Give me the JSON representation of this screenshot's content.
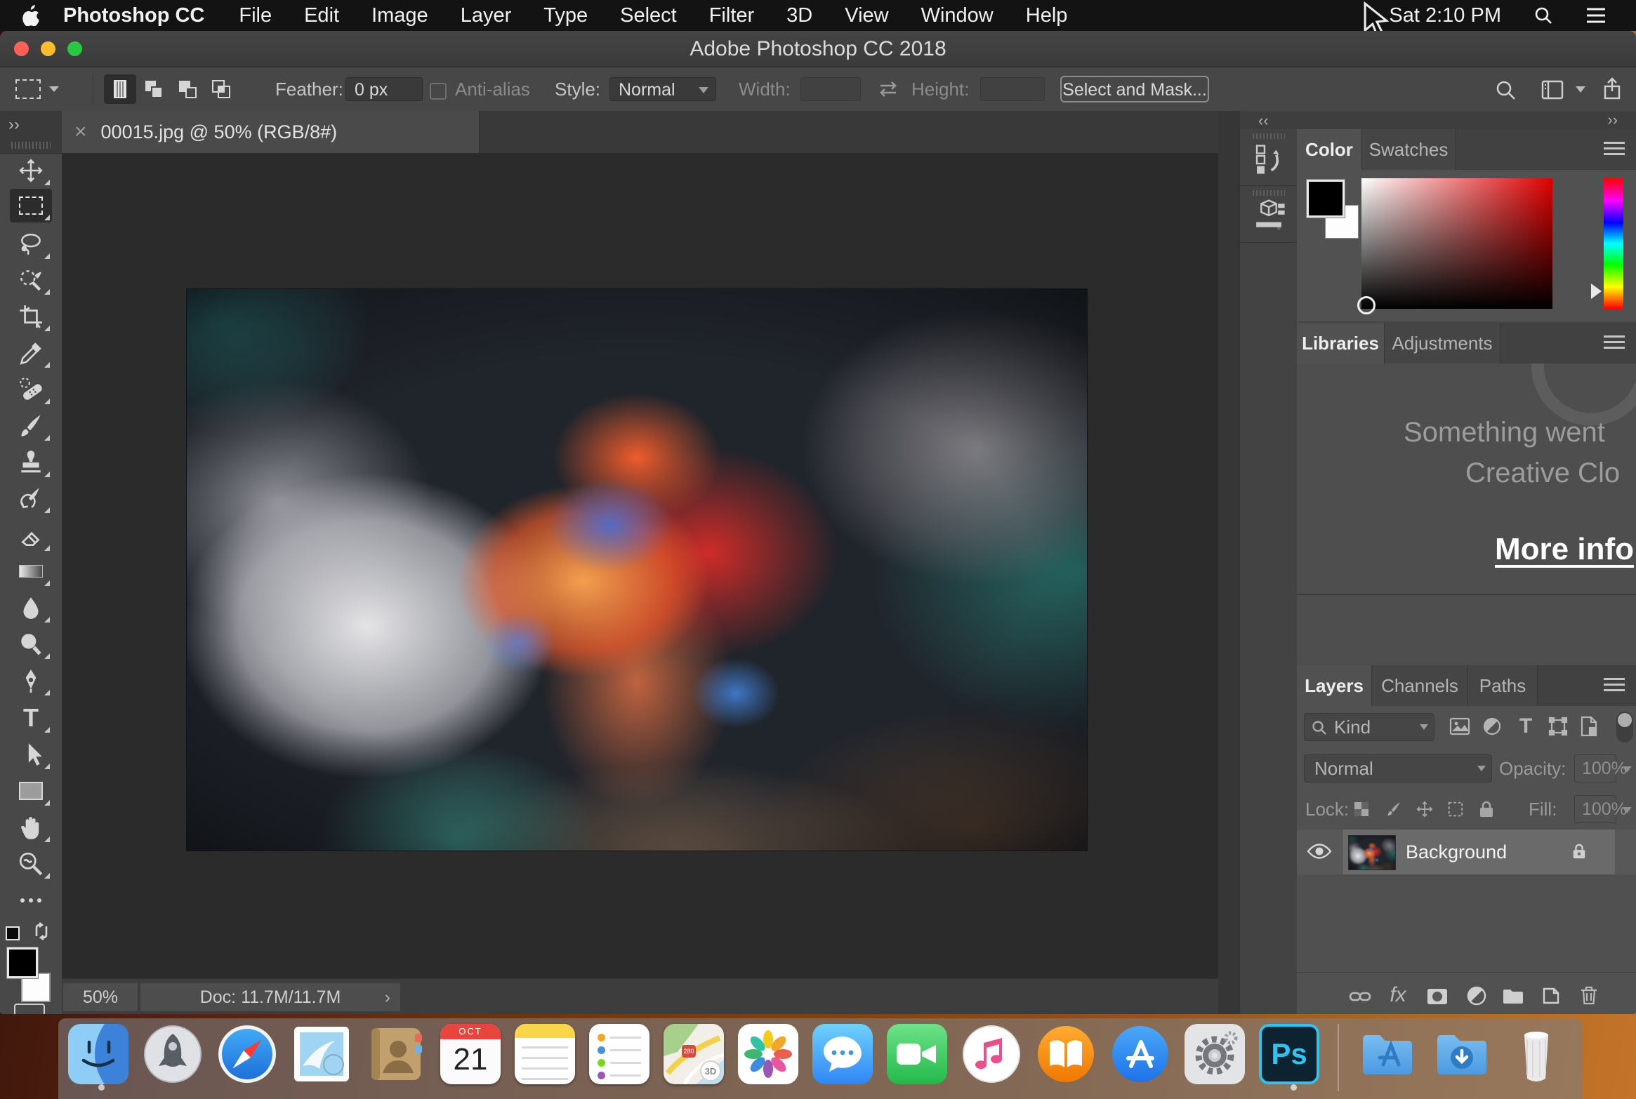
{
  "menu_bar": {
    "items": [
      "Photoshop CC",
      "File",
      "Edit",
      "Image",
      "Layer",
      "Type",
      "Select",
      "Filter",
      "3D",
      "View",
      "Window",
      "Help"
    ],
    "time": "Sat 2:10 PM"
  },
  "window": {
    "title": "Adobe Photoshop CC 2018",
    "options_bar": {
      "feather_label": "Feather:",
      "feather_value": "0 px",
      "anti_alias_label": "Anti-alias",
      "style_label": "Style:",
      "style_value": "Normal",
      "width_label": "Width:",
      "height_label": "Height:",
      "select_and_mask_label": "Select and Mask..."
    },
    "document_tab": {
      "label": "00015.jpg @ 50% (RGB/8#)"
    },
    "status_bar": {
      "zoom": "50%",
      "doc_info": "Doc: 11.7M/11.7M",
      "chevron": "›"
    }
  },
  "panels": {
    "color": {
      "tabs": [
        "Color",
        "Swatches"
      ]
    },
    "libraries": {
      "tabs": [
        "Libraries",
        "Adjustments"
      ],
      "message_line1": "Something went",
      "message_line2": "Creative Clo",
      "link": "More info"
    },
    "layers": {
      "tabs": [
        "Layers",
        "Channels",
        "Paths"
      ],
      "filter_kind": "Kind",
      "blend_mode": "Normal",
      "opacity_label": "Opacity:",
      "opacity_value": "100%",
      "lock_label": "Lock:",
      "fill_label": "Fill:",
      "fill_value": "100%",
      "layer_name": "Background",
      "fx_label": "fx"
    }
  },
  "ui": {
    "toolbar_expand": "››",
    "collapse_left": "‹‹",
    "collapse_right": "››",
    "tab_close": "×"
  },
  "dock": {
    "calendar_month": "OCT",
    "calendar_day": "21",
    "maps_3d": "3D",
    "maps_shield": "280",
    "photoshop_label": "Ps"
  },
  "colors": {
    "foreground": "#000000",
    "background": "#ffffff",
    "photoshop_accent": "#2fc3f2",
    "traffic_red": "#ff5f57",
    "traffic_yellow": "#febc2e",
    "traffic_green": "#28c840"
  }
}
